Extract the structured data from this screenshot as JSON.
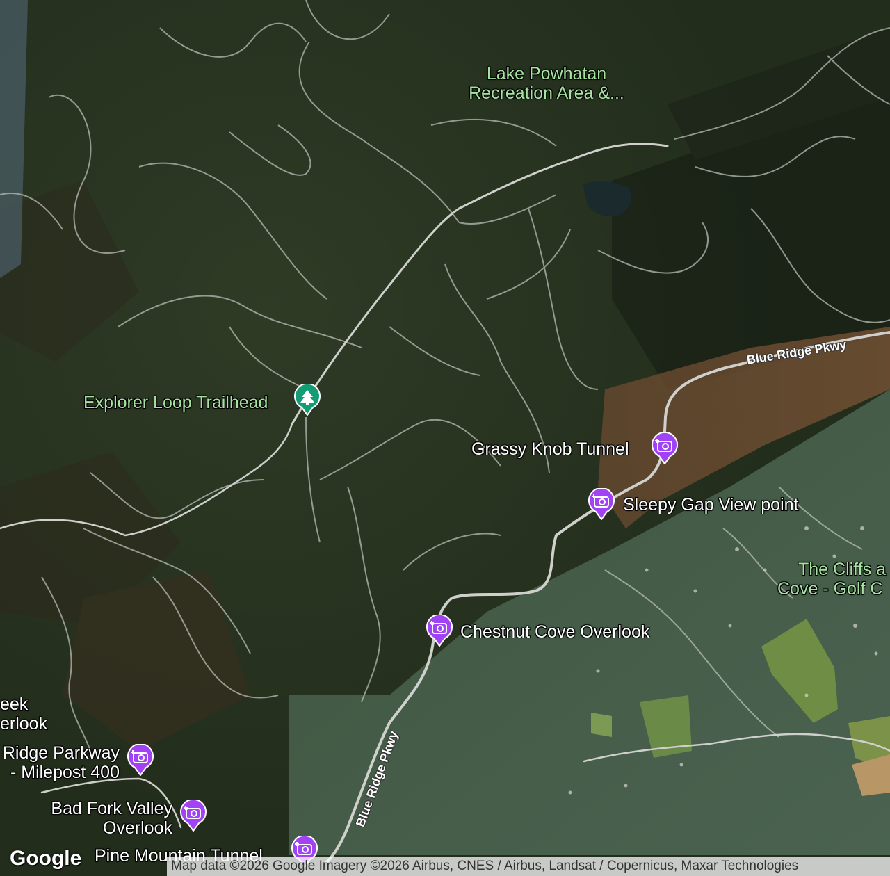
{
  "map": {
    "type": "satellite",
    "colors": {
      "poi_photo": "#a142f4",
      "poi_park": "#129e75",
      "park_label": "#a6e3a1",
      "road": "#c8c8c8"
    }
  },
  "places": {
    "lake_powhatan": {
      "line1": "Lake Powhatan",
      "line2": "Recreation Area &..."
    },
    "cliffs_cove": {
      "line1": "The Cliffs a",
      "line2": "Cove - Golf C"
    },
    "creek_overlook": {
      "line1": "eek",
      "line2": "erlook"
    }
  },
  "pois": {
    "explorer_loop": {
      "label": "Explorer Loop Trailhead",
      "icon": "tree-icon"
    },
    "grassy_knob": {
      "label": "Grassy Knob Tunnel",
      "icon": "camera-icon"
    },
    "sleepy_gap": {
      "label": "Sleepy Gap View point",
      "icon": "camera-icon"
    },
    "chestnut_cove": {
      "label": "Chestnut Cove Overlook",
      "icon": "camera-icon"
    },
    "milepost_400": {
      "line1": "Ridge Parkway",
      "line2": "- Milepost 400",
      "icon": "camera-icon"
    },
    "bad_fork": {
      "line1": "Bad Fork Valley",
      "line2": "Overlook",
      "icon": "camera-icon"
    },
    "pine_mountain": {
      "label": "Pine Mountain Tunnel",
      "icon": "camera-icon"
    }
  },
  "roads": {
    "blue_ridge_ne": "Blue Ridge Pkwy",
    "blue_ridge_s": "Blue Ridge Pkwy"
  },
  "branding": {
    "logo": "Google",
    "attribution": "Map data ©2026 Google Imagery ©2026 Airbus, CNES / Airbus, Landsat / Copernicus, Maxar Technologies"
  }
}
